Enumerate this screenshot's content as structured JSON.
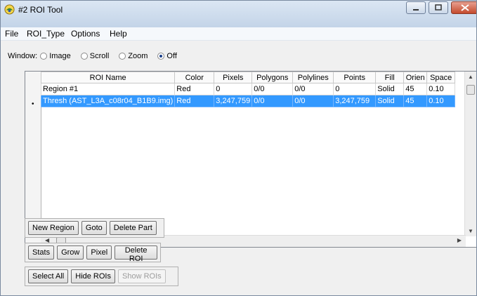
{
  "window": {
    "title": "#2 ROI Tool",
    "controls": [
      "minimize",
      "maximize",
      "close"
    ]
  },
  "menu": [
    "File",
    "ROI_Type",
    "Options",
    "Help"
  ],
  "window_mode": {
    "label": "Window:",
    "options": [
      "Image",
      "Scroll",
      "Zoom",
      "Off"
    ],
    "selected": "Off"
  },
  "table": {
    "columns": [
      "ROI Name",
      "Color",
      "Pixels",
      "Polygons",
      "Polylines",
      "Points",
      "Fill",
      "Orien",
      "Space"
    ],
    "rows": [
      {
        "cells": [
          "Region #1",
          "Red",
          "0",
          "0/0",
          "0/0",
          "0",
          "Solid",
          "45",
          "0.10"
        ],
        "selected": false
      },
      {
        "cells": [
          "Thresh (AST_L3A_c08r04_B1B9.img)",
          "Red",
          "3,247,759",
          "0/0",
          "0/0",
          "3,247,759",
          "Solid",
          "45",
          "0.10"
        ],
        "selected": true
      }
    ],
    "current_row_marker": "•"
  },
  "buttons": {
    "new_region": "New Region",
    "goto": "Goto",
    "delete_part": "Delete Part",
    "stats": "Stats",
    "grow": "Grow",
    "pixel": "Pixel",
    "delete_roi": "Delete ROI",
    "select_all": "Select All",
    "hide_rois": "Hide ROIs",
    "show_rois": "Show ROIs"
  },
  "colors": {
    "selection": "#3399ff",
    "titlebar": "#c3d4e8",
    "close_button": "#c44a2c"
  }
}
